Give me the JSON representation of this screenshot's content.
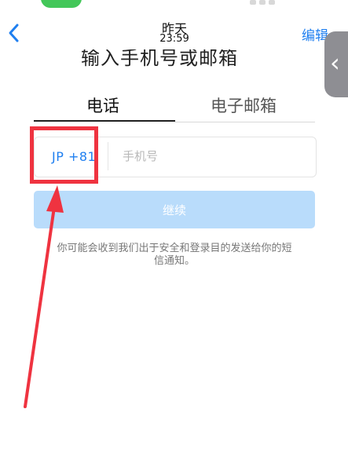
{
  "nav": {
    "back_icon": "chevron-left",
    "title": "昨天",
    "time": "23:59",
    "edit_label": "编辑"
  },
  "screen": {
    "heading": "输入手机号或邮箱",
    "tabs": [
      {
        "label": "电话",
        "active": true
      },
      {
        "label": "电子邮箱",
        "active": false
      }
    ],
    "country_code": "JP +81",
    "phone_placeholder": "手机号",
    "continue_label": "继续",
    "notice": "你可能会收到我们出于安全和登录目的发送给你的短信通知。"
  },
  "annotation": {
    "box_color": "#ef3340",
    "arrow_color": "#ef3340"
  },
  "colors": {
    "accent": "#1f7ff0",
    "button_disabled": "#b9dcfb"
  }
}
